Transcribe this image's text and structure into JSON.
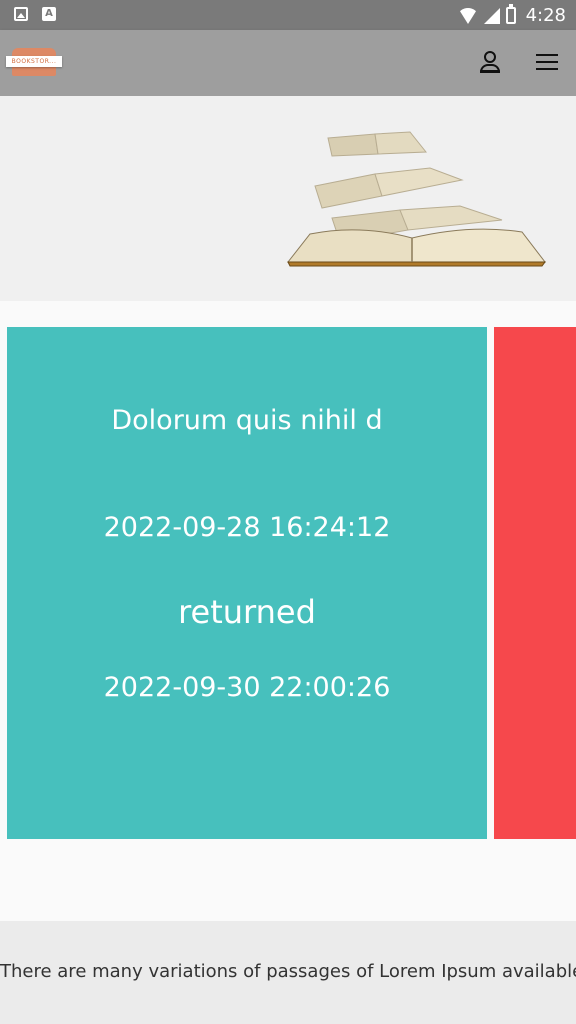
{
  "status_bar": {
    "time": "4:28",
    "left_icons": [
      "image-icon",
      "text-a-icon"
    ],
    "right_icons": [
      "wifi-icon",
      "signal-icon",
      "battery-icon"
    ]
  },
  "app_bar": {
    "logo_text": "BOOKSTOR...",
    "actions": [
      "user-account-icon",
      "menu-icon"
    ]
  },
  "hero": {
    "image": "flying-open-book-illustration"
  },
  "cards": [
    {
      "title": "Dolorum quis nihil d",
      "date_start": "2022-09-28 16:24:12",
      "status": "returned",
      "date_end": "2022-09-30 22:00:26",
      "color": "#47c0bd"
    },
    {
      "color": "#f6484c"
    }
  ],
  "footer": {
    "text": "There are many variations of passages of Lorem Ipsum available"
  }
}
